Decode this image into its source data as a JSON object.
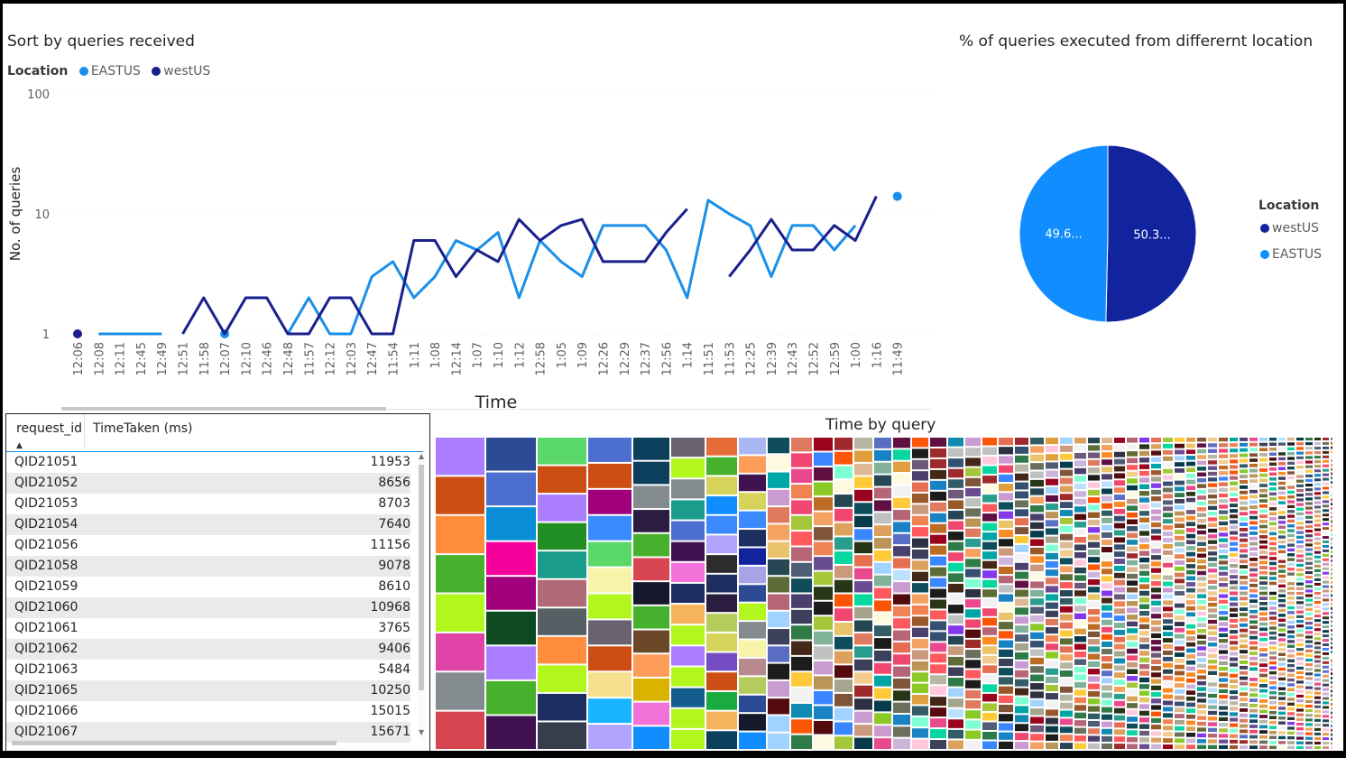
{
  "line_chart": {
    "title": "Sort by queries received",
    "legend_title": "Location",
    "series_colors": {
      "EASTUS": "#1a8fe8",
      "westUS": "#19208c"
    }
  },
  "pie_chart": {
    "title": "% of queries executed from differernt location",
    "legend_title": "Location"
  },
  "treemap": {
    "title": "Time by query"
  },
  "table": {
    "columns": [
      "request_id",
      "TimeTaken (ms)"
    ],
    "rows": [
      [
        "QID21051",
        "11953"
      ],
      [
        "QID21052",
        "8656"
      ],
      [
        "QID21053",
        "8703"
      ],
      [
        "QID21054",
        "7640"
      ],
      [
        "QID21056",
        "11156"
      ],
      [
        "QID21058",
        "9078"
      ],
      [
        "QID21059",
        "8610"
      ],
      [
        "QID21060",
        "10968"
      ],
      [
        "QID21061",
        "3765"
      ],
      [
        "QID21062",
        "9406"
      ],
      [
        "QID21063",
        "5484"
      ],
      [
        "QID21065",
        "10250"
      ],
      [
        "QID21066",
        "15015"
      ],
      [
        "QID21067",
        "15671"
      ]
    ]
  },
  "chart_data": [
    {
      "type": "line",
      "title": "Sort by queries received",
      "xlabel": "Time",
      "ylabel": "No. of queries",
      "y_scale": "log",
      "ylim": [
        1,
        100
      ],
      "y_ticks": [
        "1",
        "10",
        "100"
      ],
      "grid": true,
      "legend_position": "top-left",
      "categories": [
        "12:06",
        "12:08",
        "12:11",
        "12:45",
        "12:49",
        "12:51",
        "11:58",
        "12:07",
        "12:10",
        "12:46",
        "12:48",
        "11:57",
        "12:12",
        "12:03",
        "12:47",
        "11:54",
        "1:11",
        "1:08",
        "12:14",
        "1:07",
        "1:10",
        "1:12",
        "12:58",
        "1:05",
        "1:09",
        "12:26",
        "12:29",
        "12:37",
        "12:56",
        "1:14",
        "11:51",
        "11:53",
        "12:25",
        "12:39",
        "12:43",
        "12:52",
        "12:59",
        "1:00",
        "1:16",
        "11:49"
      ],
      "series": [
        {
          "name": "EASTUS",
          "values": [
            null,
            1,
            1,
            1,
            1,
            null,
            null,
            1,
            null,
            null,
            1,
            2,
            1,
            1,
            3,
            4,
            2,
            3,
            6,
            5,
            7,
            2,
            6,
            4,
            3,
            8,
            8,
            8,
            5,
            2,
            13,
            10,
            8,
            3,
            8,
            8,
            5,
            8,
            null,
            14
          ]
        },
        {
          "name": "westUS",
          "values": [
            1,
            null,
            null,
            null,
            null,
            1,
            2,
            1,
            2,
            2,
            1,
            1,
            2,
            2,
            1,
            1,
            6,
            6,
            3,
            5,
            4,
            9,
            6,
            8,
            9,
            4,
            4,
            4,
            7,
            11,
            null,
            3,
            5,
            9,
            5,
            5,
            8,
            6,
            14,
            null
          ]
        }
      ]
    },
    {
      "type": "pie",
      "title": "% of queries executed from differernt location",
      "legend_position": "right",
      "slices": [
        {
          "name": "westUS",
          "value": 50.3,
          "label": "50.3...",
          "color": "#12239e"
        },
        {
          "name": "EASTUS",
          "value": 49.6,
          "label": "49.6...",
          "color": "#118dff"
        }
      ]
    }
  ]
}
